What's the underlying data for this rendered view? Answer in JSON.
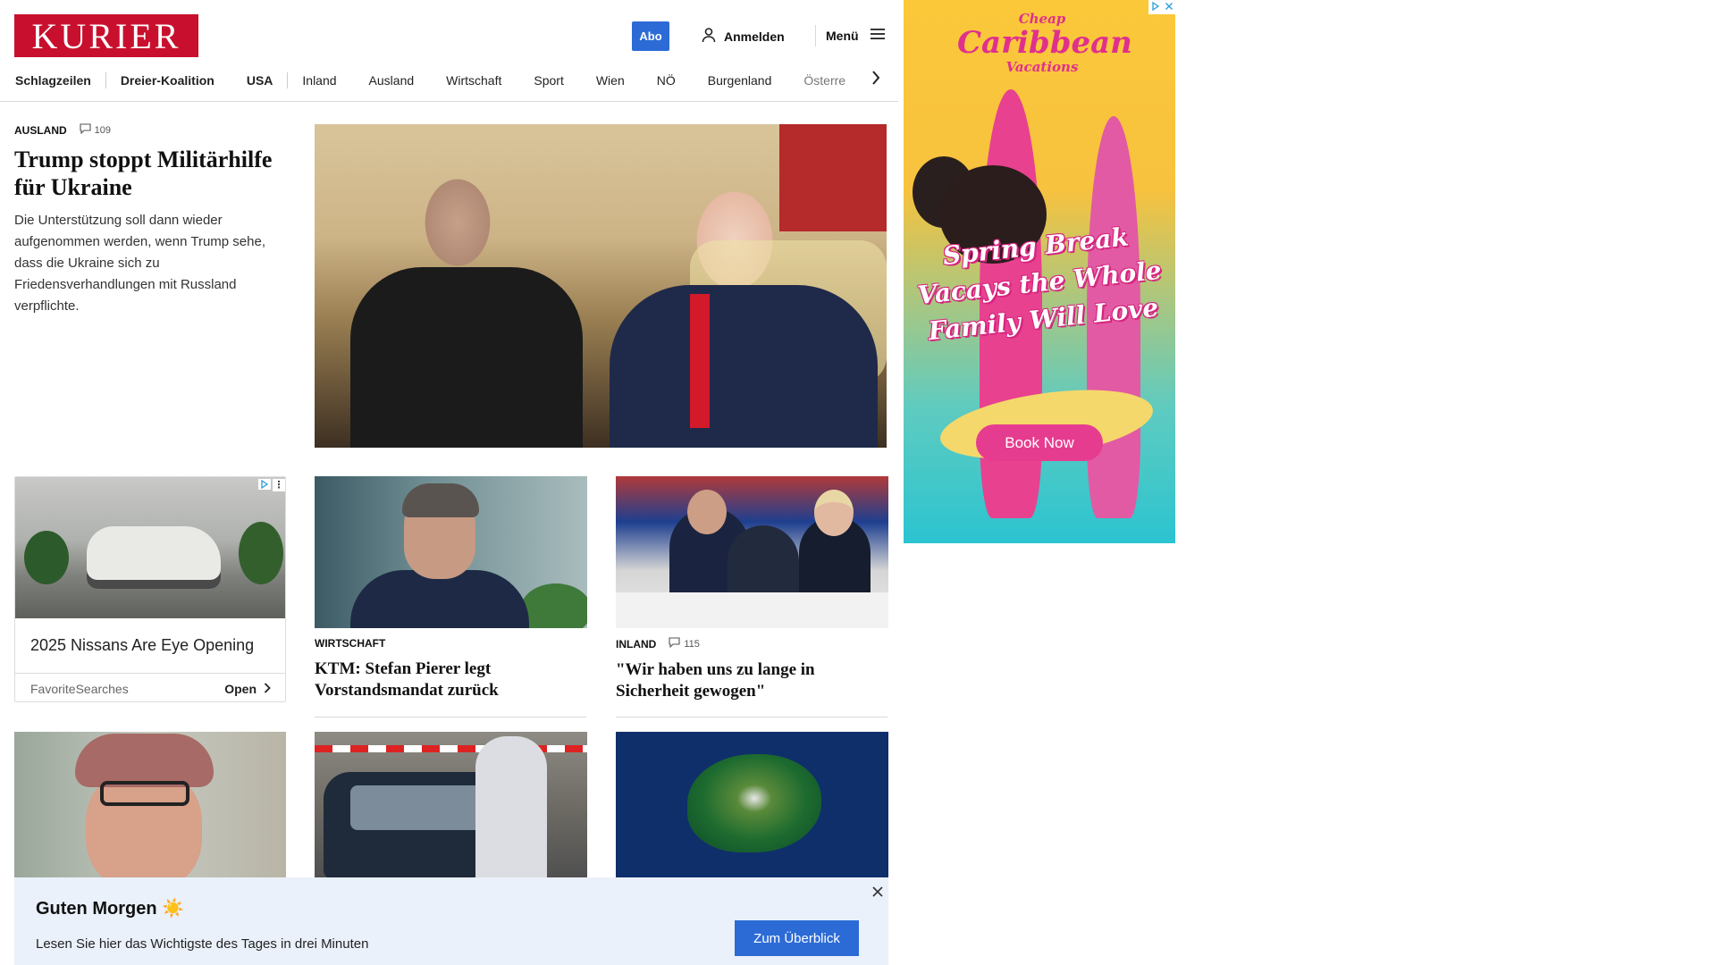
{
  "header": {
    "logo": "KURIER",
    "abo_label": "Abo",
    "login_label": "Anmelden",
    "menu_label": "Menü",
    "icons": {
      "login": "user-icon",
      "menu": "hamburger-icon",
      "nav_next": "chevron-right-icon"
    }
  },
  "nav": {
    "items": [
      "Schlagzeilen",
      "Dreier-Koalition",
      "USA",
      "Inland",
      "Ausland",
      "Wirtschaft",
      "Sport",
      "Wien",
      "NÖ",
      "Burgenland",
      "Österre"
    ]
  },
  "hero": {
    "category": "AUSLAND",
    "comments": "109",
    "title": "Trump stoppt Militärhilfe für Ukraine",
    "teaser": "Die Unterstützung soll dann wieder aufgenommen werden, wenn Trump sehe, dass die Ukraine sich zu Friedensverhandlungen mit Russland verpflichte."
  },
  "ad_card": {
    "title": "2025 Nissans Are Eye Opening",
    "source": "FavoriteSearches",
    "open_label": "Open",
    "icons": {
      "adchoices": "adchoices-icon",
      "more": "more-icon"
    }
  },
  "cards": [
    {
      "category": "WIRTSCHAFT",
      "title": "KTM: Stefan Pierer legt Vorstandsmandat zurück"
    },
    {
      "category": "INLAND",
      "comments": "115",
      "title": "\"Wir haben uns zu lange in Sicherheit gewogen\""
    }
  ],
  "side_ad": {
    "brand_top": "Cheap",
    "brand_main": "Caribbean",
    "brand_bottom": "Vacations",
    "headline": "Spring Break Vacays the Whole Family Will Love",
    "cta": "Book Now"
  },
  "banner": {
    "title": "Guten Morgen ☀️",
    "subtitle": "Lesen Sie hier das Wichtigste des Tages in drei Minuten",
    "button": "Zum Überblick"
  },
  "colors": {
    "brand_red": "#c8102e",
    "accent_blue": "#2c6bd6",
    "banner_bg": "#eaf1fa",
    "ad_pink": "#e63c8f"
  }
}
